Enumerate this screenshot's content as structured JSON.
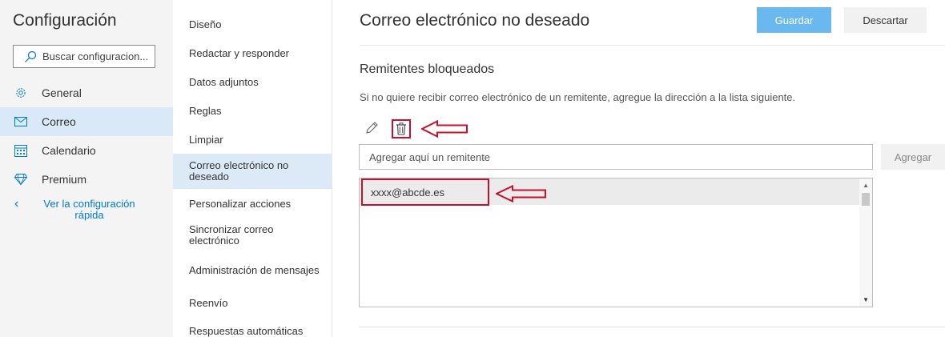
{
  "settings": {
    "title": "Configuración",
    "search_placeholder": "Buscar configuracion...",
    "categories": [
      {
        "label": "General",
        "icon": "gear-icon"
      },
      {
        "label": "Correo",
        "icon": "mail-icon",
        "active": true
      },
      {
        "label": "Calendario",
        "icon": "calendar-icon"
      },
      {
        "label": "Premium",
        "icon": "diamond-icon"
      }
    ],
    "quick_settings_label": "Ver la configuración rápida"
  },
  "subnav": {
    "items": [
      {
        "label": "Diseño"
      },
      {
        "label": "Redactar y responder"
      },
      {
        "label": "Datos adjuntos"
      },
      {
        "label": "Reglas"
      },
      {
        "label": "Limpiar"
      },
      {
        "label": "Correo electrónico no deseado",
        "active": true
      },
      {
        "label": "Personalizar acciones"
      },
      {
        "label": "Sincronizar correo electrónico"
      },
      {
        "label": "Administración de mensajes"
      },
      {
        "label": "Reenvío"
      },
      {
        "label": "Respuestas automáticas"
      }
    ]
  },
  "main": {
    "title": "Correo electrónico no deseado",
    "save_label": "Guardar",
    "discard_label": "Descartar",
    "section_title": "Remitentes bloqueados",
    "description": "Si no quiere recibir correo electrónico de un remitente, agregue la dirección a la lista siguiente.",
    "add_placeholder": "Agregar aquí un remitente",
    "add_label": "Agregar",
    "blocked_senders": [
      "xxxx@abcde.es"
    ]
  },
  "colors": {
    "accent": "#0078d4",
    "save_button": "#69b8ef",
    "annotation": "#c8102e",
    "active_nav": "#d9e9f7"
  }
}
